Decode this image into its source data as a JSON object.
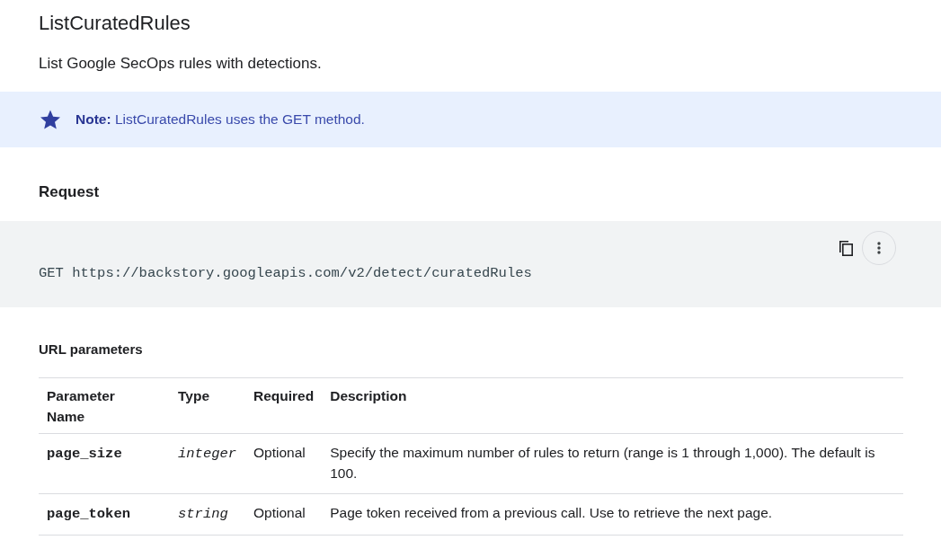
{
  "title": "ListCuratedRules",
  "description": "List Google SecOps rules with detections.",
  "note": "**Note:** ListCuratedRules uses the GET method.",
  "request": {
    "heading": "Request",
    "code": "GET https://backstory.googleapis.com/v2/detect/curatedRules"
  },
  "url_parameters": {
    "heading": "URL parameters",
    "columns": [
      "Parameter Name",
      "Type",
      "Required",
      "Description"
    ],
    "rows": [
      {
        "name": "page_size",
        "type": "integer",
        "required": "Optional",
        "description": "Specify the maximum number of rules to return (range is 1 through 1,000). The default is 100."
      },
      {
        "name": "page_token",
        "type": "string",
        "required": "Optional",
        "description": "Page token received from a previous call. Use to retrieve the next page."
      }
    ]
  }
}
